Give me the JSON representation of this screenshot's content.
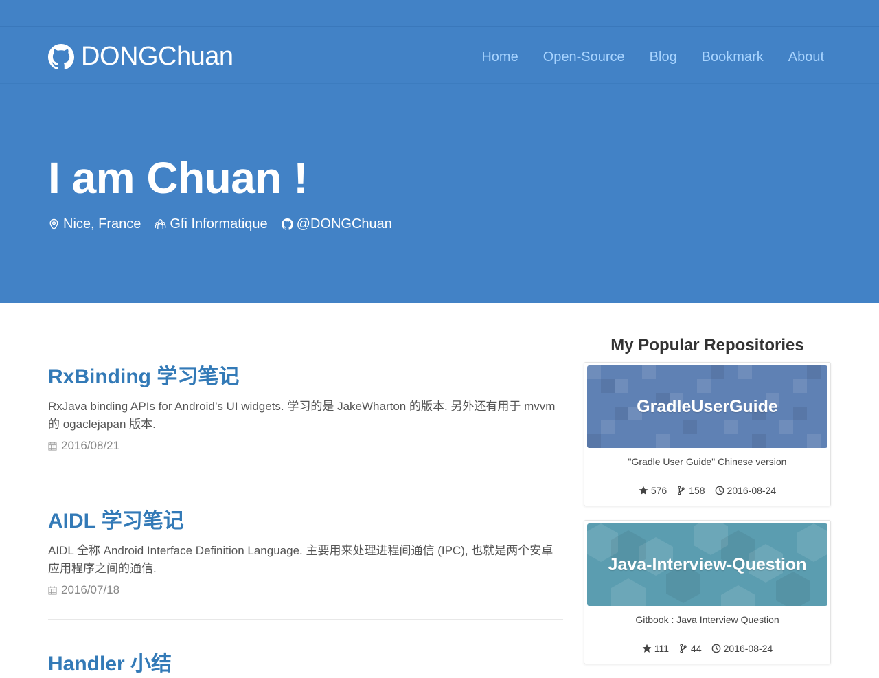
{
  "brand": {
    "name": "DONGChuan",
    "icon": "github-icon"
  },
  "nav": {
    "items": [
      "Home",
      "Open-Source",
      "Blog",
      "Bookmark",
      "About"
    ]
  },
  "hero": {
    "title": "I am Chuan !",
    "location": "Nice, France",
    "company": "Gfi Informatique",
    "github": "@DONGChuan"
  },
  "posts": [
    {
      "title": "RxBinding 学习笔记",
      "desc": "RxJava binding APIs for Android’s UI widgets. 学习的是 JakeWharton 的版本. 另外还有用于 mvvm 的 ogaclejapan 版本.",
      "date": "2016/08/21"
    },
    {
      "title": "AIDL 学习笔记",
      "desc": "AIDL 全称 Android Interface Definition Language. 主要用来处理进程间通信 (IPC), 也就是两个安卓应用程序之间的通信.",
      "date": "2016/07/18"
    },
    {
      "title": "Handler 小结",
      "desc": "",
      "date": ""
    }
  ],
  "sidebar": {
    "title": "My Popular Repositories",
    "repos": [
      {
        "name": "GradleUserGuide",
        "desc": "\"Gradle User Guide\" Chinese version",
        "stars": "576",
        "forks": "158",
        "updated": "2016-08-24",
        "color": "#5f81b4"
      },
      {
        "name": "Java-Interview-Question",
        "desc": "Gitbook : Java Interview Question",
        "stars": "111",
        "forks": "44",
        "updated": "2016-08-24",
        "color": "#5b9db0"
      }
    ]
  },
  "colors": {
    "primary": "#4282c6",
    "link": "#337ab7",
    "nav_link": "#a8d4ff"
  }
}
